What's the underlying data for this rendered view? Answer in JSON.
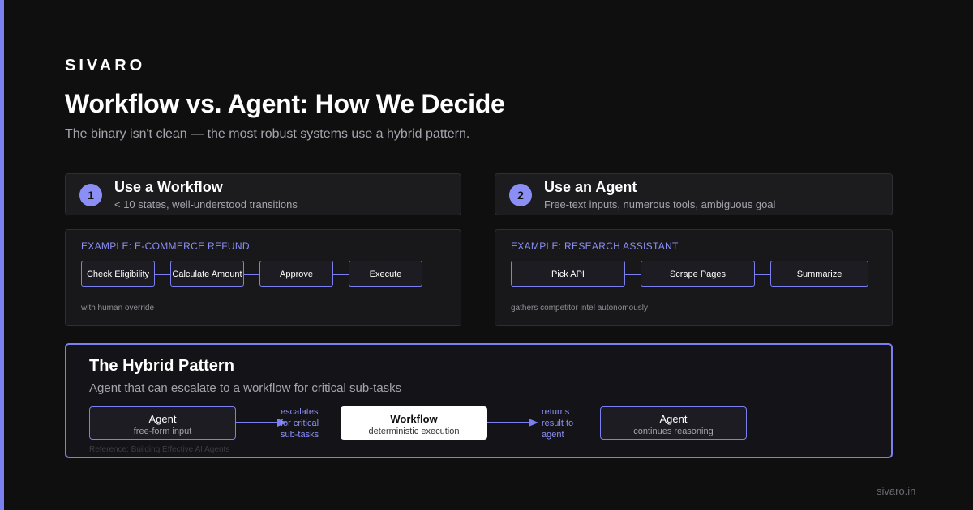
{
  "brand": "SIVARO",
  "title": "Workflow vs. Agent: How We Decide",
  "subtitle": "The binary isn't clean — the most robust systems use a hybrid pattern.",
  "options": [
    {
      "number": "1",
      "title": "Use a Workflow",
      "description": "< 10 states, well-understood transitions",
      "example_label": "EXAMPLE: E-COMMERCE REFUND",
      "steps": [
        "Check Eligibility",
        "Calculate Amount",
        "Approve",
        "Execute"
      ],
      "note": "with human override"
    },
    {
      "number": "2",
      "title": "Use an Agent",
      "description": "Free-text inputs, numerous tools, ambiguous goal",
      "example_label": "EXAMPLE: RESEARCH ASSISTANT",
      "steps": [
        "Pick API",
        "Scrape Pages",
        "Summarize"
      ],
      "note": "gathers competitor intel autonomously"
    }
  ],
  "hybrid": {
    "title": "The Hybrid Pattern",
    "subtitle": "Agent that can escalate to a workflow for critical sub-tasks",
    "nodes": [
      {
        "title": "Agent",
        "sub": "free-form input"
      },
      {
        "title": "Workflow",
        "sub": "deterministic execution"
      },
      {
        "title": "Agent",
        "sub": "continues reasoning"
      }
    ],
    "edges": [
      {
        "label": [
          "escalates",
          "for critical",
          "sub-tasks"
        ]
      },
      {
        "label": [
          "returns",
          "result to",
          "agent"
        ]
      }
    ],
    "reference": "Reference: Building Effective AI Agents"
  },
  "footer": "sivaro.in",
  "colors": {
    "accent": "#7b7ff0",
    "background": "#0f0f10"
  }
}
